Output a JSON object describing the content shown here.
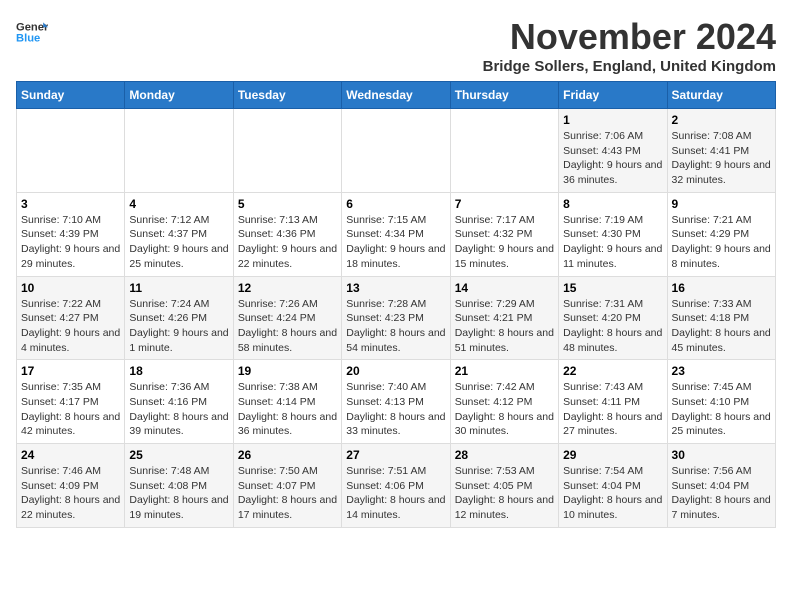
{
  "logo": {
    "line1": "General",
    "line2": "Blue"
  },
  "title": "November 2024",
  "subtitle": "Bridge Sollers, England, United Kingdom",
  "weekdays": [
    "Sunday",
    "Monday",
    "Tuesday",
    "Wednesday",
    "Thursday",
    "Friday",
    "Saturday"
  ],
  "weeks": [
    [
      {
        "day": "",
        "info": ""
      },
      {
        "day": "",
        "info": ""
      },
      {
        "day": "",
        "info": ""
      },
      {
        "day": "",
        "info": ""
      },
      {
        "day": "",
        "info": ""
      },
      {
        "day": "1",
        "info": "Sunrise: 7:06 AM\nSunset: 4:43 PM\nDaylight: 9 hours and 36 minutes."
      },
      {
        "day": "2",
        "info": "Sunrise: 7:08 AM\nSunset: 4:41 PM\nDaylight: 9 hours and 32 minutes."
      }
    ],
    [
      {
        "day": "3",
        "info": "Sunrise: 7:10 AM\nSunset: 4:39 PM\nDaylight: 9 hours and 29 minutes."
      },
      {
        "day": "4",
        "info": "Sunrise: 7:12 AM\nSunset: 4:37 PM\nDaylight: 9 hours and 25 minutes."
      },
      {
        "day": "5",
        "info": "Sunrise: 7:13 AM\nSunset: 4:36 PM\nDaylight: 9 hours and 22 minutes."
      },
      {
        "day": "6",
        "info": "Sunrise: 7:15 AM\nSunset: 4:34 PM\nDaylight: 9 hours and 18 minutes."
      },
      {
        "day": "7",
        "info": "Sunrise: 7:17 AM\nSunset: 4:32 PM\nDaylight: 9 hours and 15 minutes."
      },
      {
        "day": "8",
        "info": "Sunrise: 7:19 AM\nSunset: 4:30 PM\nDaylight: 9 hours and 11 minutes."
      },
      {
        "day": "9",
        "info": "Sunrise: 7:21 AM\nSunset: 4:29 PM\nDaylight: 9 hours and 8 minutes."
      }
    ],
    [
      {
        "day": "10",
        "info": "Sunrise: 7:22 AM\nSunset: 4:27 PM\nDaylight: 9 hours and 4 minutes."
      },
      {
        "day": "11",
        "info": "Sunrise: 7:24 AM\nSunset: 4:26 PM\nDaylight: 9 hours and 1 minute."
      },
      {
        "day": "12",
        "info": "Sunrise: 7:26 AM\nSunset: 4:24 PM\nDaylight: 8 hours and 58 minutes."
      },
      {
        "day": "13",
        "info": "Sunrise: 7:28 AM\nSunset: 4:23 PM\nDaylight: 8 hours and 54 minutes."
      },
      {
        "day": "14",
        "info": "Sunrise: 7:29 AM\nSunset: 4:21 PM\nDaylight: 8 hours and 51 minutes."
      },
      {
        "day": "15",
        "info": "Sunrise: 7:31 AM\nSunset: 4:20 PM\nDaylight: 8 hours and 48 minutes."
      },
      {
        "day": "16",
        "info": "Sunrise: 7:33 AM\nSunset: 4:18 PM\nDaylight: 8 hours and 45 minutes."
      }
    ],
    [
      {
        "day": "17",
        "info": "Sunrise: 7:35 AM\nSunset: 4:17 PM\nDaylight: 8 hours and 42 minutes."
      },
      {
        "day": "18",
        "info": "Sunrise: 7:36 AM\nSunset: 4:16 PM\nDaylight: 8 hours and 39 minutes."
      },
      {
        "day": "19",
        "info": "Sunrise: 7:38 AM\nSunset: 4:14 PM\nDaylight: 8 hours and 36 minutes."
      },
      {
        "day": "20",
        "info": "Sunrise: 7:40 AM\nSunset: 4:13 PM\nDaylight: 8 hours and 33 minutes."
      },
      {
        "day": "21",
        "info": "Sunrise: 7:42 AM\nSunset: 4:12 PM\nDaylight: 8 hours and 30 minutes."
      },
      {
        "day": "22",
        "info": "Sunrise: 7:43 AM\nSunset: 4:11 PM\nDaylight: 8 hours and 27 minutes."
      },
      {
        "day": "23",
        "info": "Sunrise: 7:45 AM\nSunset: 4:10 PM\nDaylight: 8 hours and 25 minutes."
      }
    ],
    [
      {
        "day": "24",
        "info": "Sunrise: 7:46 AM\nSunset: 4:09 PM\nDaylight: 8 hours and 22 minutes."
      },
      {
        "day": "25",
        "info": "Sunrise: 7:48 AM\nSunset: 4:08 PM\nDaylight: 8 hours and 19 minutes."
      },
      {
        "day": "26",
        "info": "Sunrise: 7:50 AM\nSunset: 4:07 PM\nDaylight: 8 hours and 17 minutes."
      },
      {
        "day": "27",
        "info": "Sunrise: 7:51 AM\nSunset: 4:06 PM\nDaylight: 8 hours and 14 minutes."
      },
      {
        "day": "28",
        "info": "Sunrise: 7:53 AM\nSunset: 4:05 PM\nDaylight: 8 hours and 12 minutes."
      },
      {
        "day": "29",
        "info": "Sunrise: 7:54 AM\nSunset: 4:04 PM\nDaylight: 8 hours and 10 minutes."
      },
      {
        "day": "30",
        "info": "Sunrise: 7:56 AM\nSunset: 4:04 PM\nDaylight: 8 hours and 7 minutes."
      }
    ]
  ]
}
